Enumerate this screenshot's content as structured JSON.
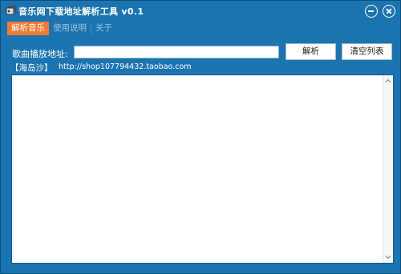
{
  "window": {
    "title": "音乐网下载地址解析工具 v0.1"
  },
  "menu": {
    "items": [
      {
        "label": "解析音乐"
      },
      {
        "label": "使用说明"
      },
      {
        "label": "关于"
      }
    ]
  },
  "form": {
    "url_label": "歌曲播放地址:",
    "url_value": "",
    "parse_button": "解析",
    "clear_button": "清空列表"
  },
  "footer": {
    "tag": "【海岛沙】",
    "shop_url": "http://shop107794432.taobao.com"
  },
  "colors": {
    "window_bg": "#1b74b0",
    "accent_tab": "#f07a35"
  },
  "icons": {
    "app": "app-icon",
    "minimize": "minimize-icon",
    "close": "close-icon",
    "scroll_up": "chevron-up-icon",
    "scroll_down": "chevron-down-icon"
  }
}
